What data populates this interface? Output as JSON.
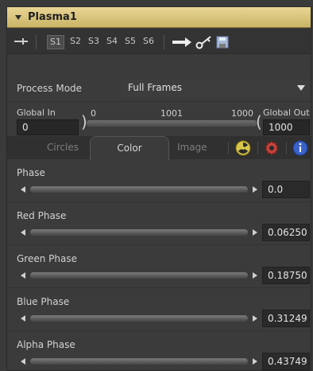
{
  "header": {
    "title": "Plasma1"
  },
  "toolbar": {
    "slots": [
      "S1",
      "S2",
      "S3",
      "S4",
      "S5",
      "S6"
    ],
    "active_slot": "S1"
  },
  "process_mode": {
    "label": "Process Mode",
    "value": "Full Frames"
  },
  "range": {
    "global_in_label": "Global In",
    "global_out_label": "Global Out",
    "global_in_value": "0",
    "global_out_value": "1000",
    "range_start": "0",
    "range_middle": "1001",
    "range_end": "1000"
  },
  "tabs": {
    "circles": "Circles",
    "color": "Color",
    "image": "Image",
    "active": "Color"
  },
  "params": [
    {
      "label": "Phase",
      "value": "0.0"
    },
    {
      "label": "Red Phase",
      "value": "0.06250"
    },
    {
      "label": "Green Phase",
      "value": "0.18750"
    },
    {
      "label": "Blue Phase",
      "value": "0.31249"
    },
    {
      "label": "Alpha Phase",
      "value": "0.43749"
    }
  ],
  "icons": {
    "header": "collapse-triangle-icon",
    "toolbar": [
      "pin-icon",
      "arrow-right-icon",
      "key-icon",
      "save-icon"
    ],
    "tabs": [
      "radioactive-icon",
      "gear-icon",
      "info-icon"
    ]
  }
}
